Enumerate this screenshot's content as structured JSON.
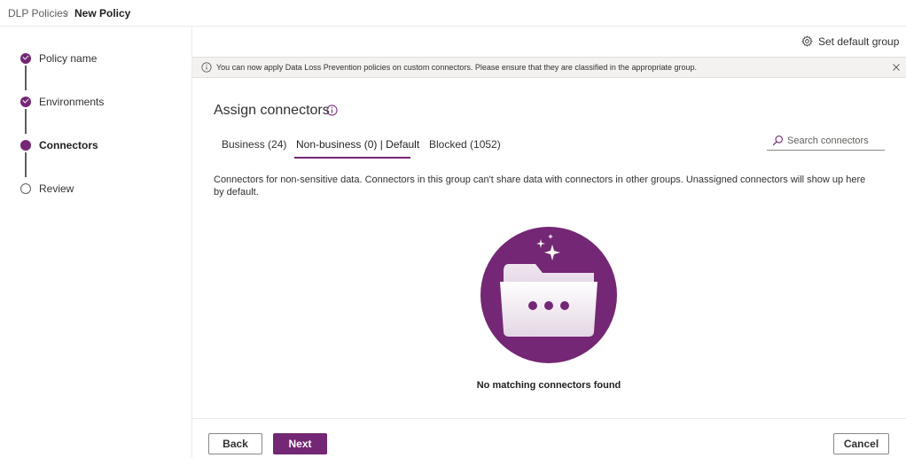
{
  "breadcrumb": {
    "parent": "DLP Policies",
    "current": "New Policy"
  },
  "steps": [
    {
      "label": "Policy name",
      "state": "done"
    },
    {
      "label": "Environments",
      "state": "done"
    },
    {
      "label": "Connectors",
      "state": "current"
    },
    {
      "label": "Review",
      "state": "todo"
    }
  ],
  "toolbar": {
    "set_default_label": "Set default group"
  },
  "infobar": {
    "text": "You can now apply Data Loss Prevention policies on custom connectors. Please ensure that they are classified in the appropriate group."
  },
  "main": {
    "title": "Assign connectors",
    "tabs": [
      {
        "label": "Business (24)",
        "selected": false
      },
      {
        "label": "Non-business (0) | Default",
        "selected": true
      },
      {
        "label": "Blocked (1052)",
        "selected": false
      }
    ],
    "search": {
      "placeholder": "Search connectors",
      "value": ""
    },
    "description": "Connectors for non-sensitive data. Connectors in this group can't share data with connectors in other groups. Unassigned connectors will show up here by default.",
    "empty_message": "No matching connectors found"
  },
  "footer": {
    "back_label": "Back",
    "next_label": "Next",
    "cancel_label": "Cancel"
  },
  "colors": {
    "accent": "#742774",
    "border": "#8a8886",
    "infobar_bg": "#f3f2f1"
  },
  "icons": {
    "settings": "gear-icon",
    "info": "info-icon",
    "close": "close-icon",
    "search": "search-icon",
    "illustration": "folder-illustration"
  }
}
